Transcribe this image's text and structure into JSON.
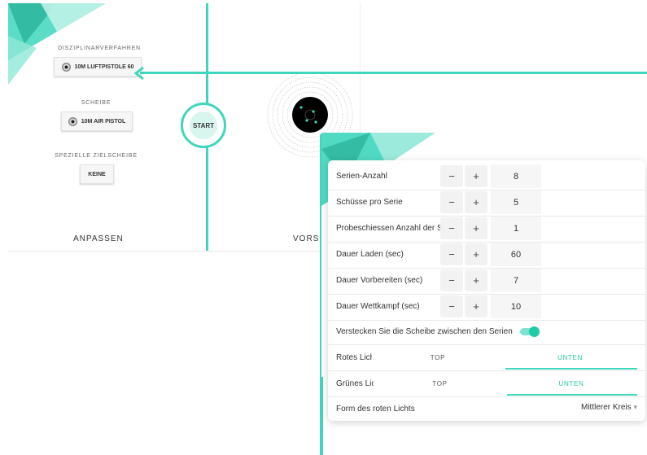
{
  "colors": {
    "accent": "#3ed6bc",
    "accent_dark": "#21cba8",
    "text": "#333333"
  },
  "background_screen": {
    "disziplin_label": "DISZIPLINARVERFAHREN",
    "disziplin_value": "10M LUFTPISTOLE 60",
    "scheibe_label": "SCHEIBE",
    "scheibe_value": "10M AIR PISTOL",
    "spezielle_label": "SPEZIELLE ZIELSCHEIBE",
    "spezielle_value": "KEINE",
    "start_label": "START",
    "anpassen_label": "ANPASSEN",
    "vorschau_label": "VORSC"
  },
  "settings": {
    "rows": [
      {
        "label": "Serien-Anzahl",
        "minus": "−",
        "plus": "+",
        "value": "8"
      },
      {
        "label": "Schüsse pro Serie",
        "minus": "−",
        "plus": "+",
        "value": "5"
      },
      {
        "label": "Probeschiessen Anzahl der Serien",
        "minus": "−",
        "plus": "+",
        "value": "1"
      },
      {
        "label": "Dauer Laden (sec)",
        "minus": "−",
        "plus": "+",
        "value": "60"
      },
      {
        "label": "Dauer Vorbereiten (sec)",
        "minus": "−",
        "plus": "+",
        "value": "7"
      },
      {
        "label": "Dauer Wettkampf (sec)",
        "minus": "−",
        "plus": "+",
        "value": "10"
      }
    ],
    "hide_target_label": "Verstecken Sie die Scheibe zwischen den Serien",
    "hide_target_on": true,
    "red_light": {
      "label": "Rotes Licht",
      "option_top": "TOP",
      "option_bottom": "UNTEN",
      "selected": "UNTEN"
    },
    "green_light": {
      "label": "Grünes Licht",
      "option_top": "TOP",
      "option_bottom": "UNTEN",
      "selected": "UNTEN"
    },
    "red_shape": {
      "label": "Form des roten Lichts",
      "value": "Mittlerer Kreis",
      "caret": "▾"
    }
  }
}
